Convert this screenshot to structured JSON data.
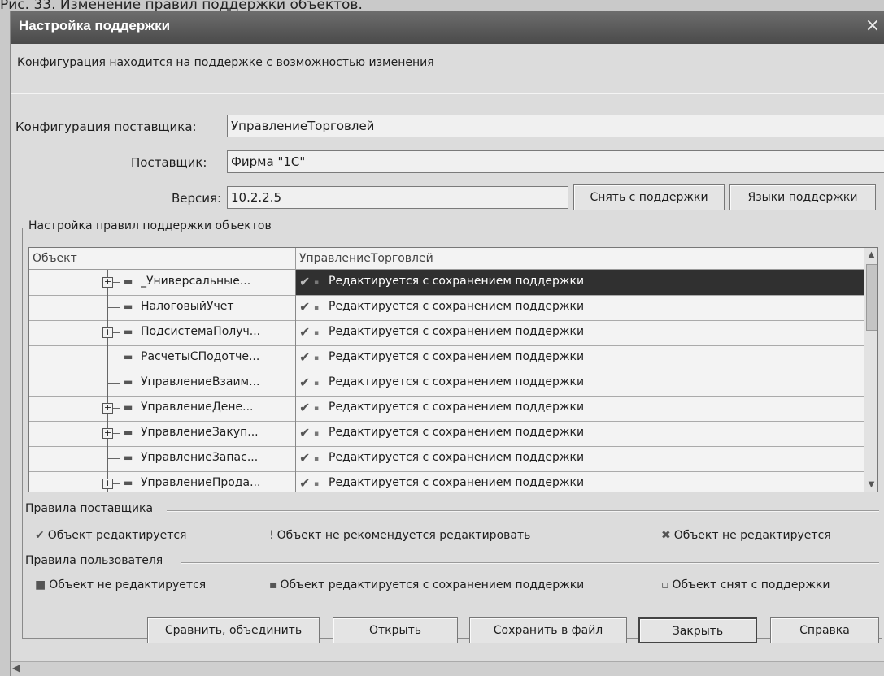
{
  "page_caption": "Рис. 33. Изменение правил поддержки объектов.",
  "window": {
    "title": "Настройка поддержки",
    "close": "×"
  },
  "info_text": "Конфигурация находится на поддержке с возможностью изменения",
  "fields": {
    "vendor_config_label": "Конфигурация поставщика:",
    "vendor_config_value": "УправлениеТорговлей",
    "vendor_label": "Поставщик:",
    "vendor_value": "Фирма \"1С\"",
    "version_label": "Версия:",
    "version_value": "10.2.2.5"
  },
  "buttons": {
    "remove_support": "Снять с поддержки",
    "support_languages": "Языки поддержки",
    "compare_merge": "Сравнить, объединить",
    "open": "Открыть",
    "save_to_file": "Сохранить в файл",
    "close": "Закрыть",
    "help": "Справка"
  },
  "group_title": "Настройка правил поддержки объектов",
  "grid": {
    "columns": [
      "Объект",
      "УправлениеТорговлей"
    ],
    "rows": [
      {
        "name": "_Универсальные...",
        "expandable": true,
        "rule": "Редактируется с сохранением поддержки",
        "selected": true
      },
      {
        "name": "НалоговыйУчет",
        "expandable": false,
        "rule": "Редактируется с сохранением поддержки",
        "selected": false
      },
      {
        "name": "ПодсистемаПолуч...",
        "expandable": true,
        "rule": "Редактируется с сохранением поддержки",
        "selected": false
      },
      {
        "name": "РасчетыСПодотче...",
        "expandable": false,
        "rule": "Редактируется с сохранением поддержки",
        "selected": false
      },
      {
        "name": "УправлениеВзаим...",
        "expandable": false,
        "rule": "Редактируется с сохранением поддержки",
        "selected": false
      },
      {
        "name": "УправлениеДене...",
        "expandable": true,
        "rule": "Редактируется с сохранением поддержки",
        "selected": false
      },
      {
        "name": "УправлениеЗакуп...",
        "expandable": true,
        "rule": "Редактируется с сохранением поддержки",
        "selected": false
      },
      {
        "name": "УправлениеЗапас...",
        "expandable": false,
        "rule": "Редактируется с сохранением поддержки",
        "selected": false
      },
      {
        "name": "УправлениеПрода...",
        "expandable": true,
        "rule": "Редактируется с сохранением поддержки",
        "selected": false
      }
    ]
  },
  "vendor_rules": {
    "title": "Правила поставщика",
    "items": [
      {
        "icon": "check-icon",
        "label": "Объект редактируется"
      },
      {
        "icon": "warning-icon",
        "label": "Объект не рекомендуется редактировать"
      },
      {
        "icon": "cross-icon",
        "label": "Объект не редактируется"
      }
    ]
  },
  "user_rules": {
    "title": "Правила пользователя",
    "items": [
      {
        "icon": "lock-icon",
        "label": "Объект не редактируется"
      },
      {
        "icon": "lock-partial-icon",
        "label": "Объект редактируется с сохранением поддержки"
      },
      {
        "icon": "unlocked-icon",
        "label": "Объект снят с поддержки"
      }
    ]
  }
}
